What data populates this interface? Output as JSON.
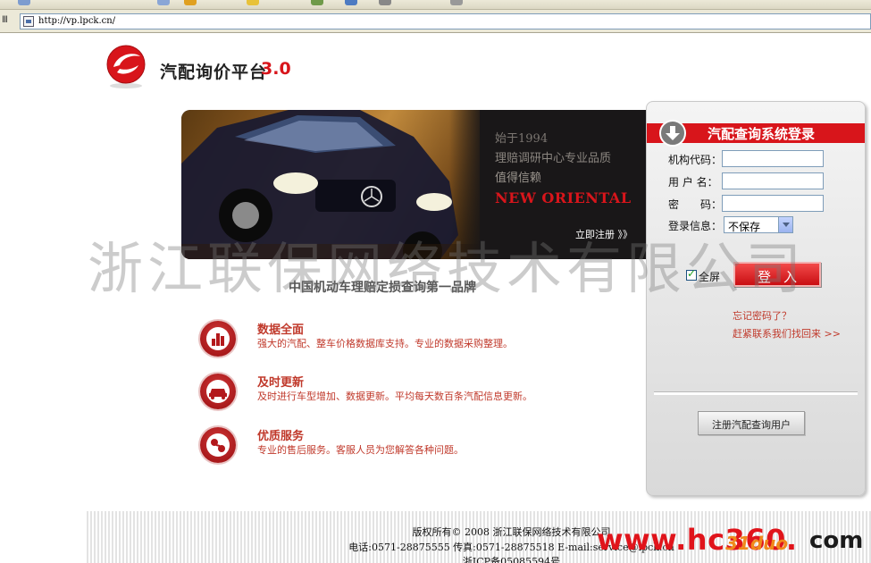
{
  "browser": {
    "address_label": "Ⅲ",
    "url": "http://vp.lpck.cn/"
  },
  "logo": {
    "name": "汽配询价平台",
    "version": "3.0"
  },
  "banner": {
    "line1": "始于1994",
    "line2": "理赔调研中心专业品质",
    "line3": "值得信赖",
    "brand": "NEW ORIENTAL",
    "register_link": "立即注册 》》"
  },
  "watermark": "浙江联保网络技术有限公司",
  "slogan": "中国机动车理赔定损查询第一品牌",
  "features": [
    {
      "title": "数据全面",
      "desc": "强大的汽配、整车价格数据库支持。专业的数据采购整理。",
      "icon": "bar-chart-icon"
    },
    {
      "title": "及时更新",
      "desc": "及时进行车型增加、数据更新。平均每天数百条汽配信息更新。",
      "icon": "car-icon"
    },
    {
      "title": "优质服务",
      "desc": "专业的售后服务。客服人员为您解答各种问题。",
      "icon": "service-icon"
    }
  ],
  "login": {
    "title": "汽配查询系统登录",
    "org_code_label": "机构代码：",
    "username_label": "用 户 名：",
    "password_label": "密　　码：",
    "login_info_label": "登录信息：",
    "login_info_value": "不保存",
    "fullscreen_label": "全屏",
    "submit_label": "登入",
    "forgot_password": "忘记密码了？",
    "contact_recover": "赶紧联系我们找回来 >>",
    "register_button": "注册汽配查询用户"
  },
  "footer": {
    "copyright": "版权所有© 2008 浙江联保网络技术有限公司",
    "contact": "电话:0571-28875555 传真:0571-28875518 E-mail:service@lpck.cn",
    "icp": "浙ICP备05085594号"
  },
  "site_watermark": {
    "main": "www.hc360.",
    "suffix": "com",
    "badge": "31duo"
  },
  "colors": {
    "brand_red": "#d8151b",
    "link_red": "#c0392b",
    "banner_bg": "#191718"
  }
}
